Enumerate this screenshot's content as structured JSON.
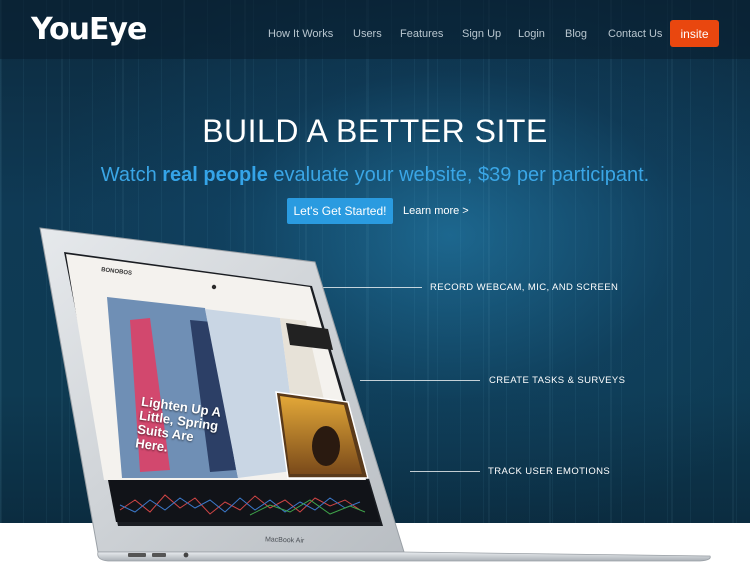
{
  "brand": {
    "logo_text": "YouEye"
  },
  "nav": {
    "links": [
      "How It Works",
      "Users",
      "Features",
      "Sign Up",
      "Login",
      "Blog",
      "Contact Us"
    ],
    "cta": "insite"
  },
  "hero": {
    "headline": "BUILD A BETTER SITE",
    "subhead_before": "Watch ",
    "subhead_bold": "real people",
    "subhead_after": " evaluate your website, $39 per participant.",
    "cta_label": "Let's Get Started!",
    "learn_more": "Learn more >"
  },
  "callouts": [
    "RECORD WEBCAM, MIC, AND SCREEN",
    "CREATE TASKS & SURVEYS",
    "TRACK USER EMOTIONS"
  ],
  "laptop": {
    "brand_label": "MacBook Air",
    "site_brand": "BONOBOS",
    "promo_text": "Lighten Up A Little, Spring Suits Are Here."
  },
  "colors": {
    "accent_blue": "#2a9be0",
    "insite_orange": "#e9470f",
    "hero_dark": "#0f3a55"
  }
}
